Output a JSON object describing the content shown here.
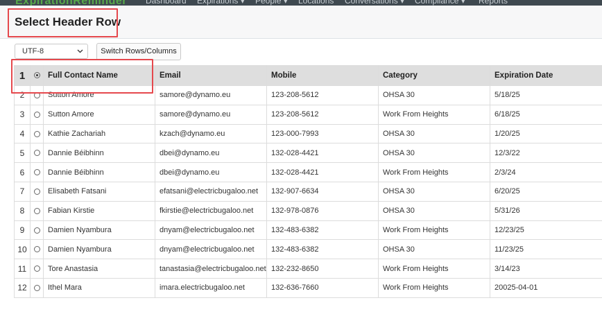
{
  "navbar": {
    "logo": "ExpirationReminder",
    "items": [
      "Dashboard",
      "Expirations ▾",
      "People ▾",
      "Locations",
      "Conversations ▾",
      "Compliance ▾",
      "Reports"
    ]
  },
  "modal": {
    "title": "Select Header Row"
  },
  "controls": {
    "encoding_value": "UTF-8",
    "switch_label": "Switch Rows/Columns"
  },
  "table": {
    "header_row_number": "1",
    "columns": [
      "Full Contact Name",
      "Email",
      "Mobile",
      "Category",
      "Expiration Date"
    ],
    "rows": [
      {
        "num": "2",
        "cells": [
          "Sutton Amore",
          "samore@dynamo.eu",
          "123-208-5612",
          "OHSA 30",
          "5/18/25"
        ]
      },
      {
        "num": "3",
        "cells": [
          "Sutton Amore",
          "samore@dynamo.eu",
          "123-208-5612",
          "Work From Heights",
          "6/18/25"
        ]
      },
      {
        "num": "4",
        "cells": [
          "Kathie Zachariah",
          "kzach@dynamo.eu",
          "123-000-7993",
          "OHSA 30",
          "1/20/25"
        ]
      },
      {
        "num": "5",
        "cells": [
          "Dannie Béibhinn",
          "dbei@dynamo.eu",
          "132-028-4421",
          "OHSA 30",
          "12/3/22"
        ]
      },
      {
        "num": "6",
        "cells": [
          "Dannie Béibhinn",
          "dbei@dynamo.eu",
          "132-028-4421",
          "Work From Heights",
          "2/3/24"
        ]
      },
      {
        "num": "7",
        "cells": [
          "Elisabeth Fatsani",
          "efatsani@electricbugaloo.net",
          "132-907-6634",
          "OHSA 30",
          "6/20/25"
        ]
      },
      {
        "num": "8",
        "cells": [
          "Fabian Kirstie",
          "fkirstie@electricbugaloo.net",
          "132-978-0876",
          "OHSA 30",
          "5/31/26"
        ]
      },
      {
        "num": "9",
        "cells": [
          "Damien Nyambura",
          "dnyam@electricbugaloo.net",
          "132-483-6382",
          "Work From Heights",
          "12/23/25"
        ]
      },
      {
        "num": "10",
        "cells": [
          "Damien Nyambura",
          "dnyam@electricbugaloo.net",
          "132-483-6382",
          "OHSA 30",
          "11/23/25"
        ]
      },
      {
        "num": "11",
        "cells": [
          "Tore Anastasia",
          "tanastasia@electricbugaloo.net",
          "132-232-8650",
          "Work From Heights",
          "3/14/23"
        ]
      },
      {
        "num": "12",
        "cells": [
          "Ithel Mara",
          "imara.electricbugaloo.net",
          "132-636-7660",
          "Work From Heights",
          "20025-04-01"
        ]
      }
    ]
  },
  "colors": {
    "highlight": "#e5484d",
    "header_bg": "#dedede",
    "navbar_bg": "#3f4950"
  }
}
